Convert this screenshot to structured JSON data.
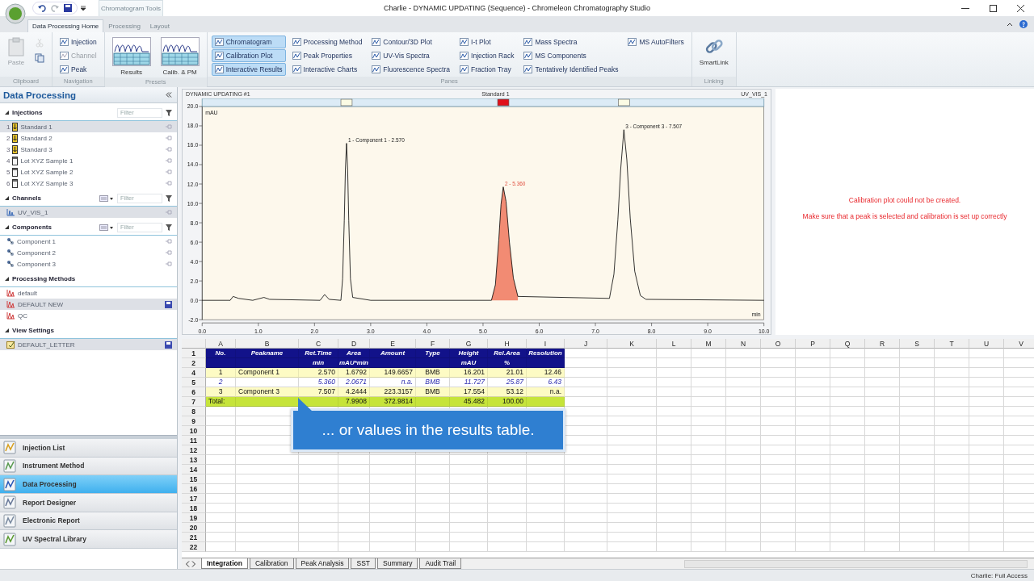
{
  "window": {
    "title": "Charlie - DYNAMIC UPDATING (Sequence) - Chromeleon Chromatography Studio",
    "context_group": "Chromatogram Tools"
  },
  "tabs": [
    {
      "label": "Data Processing Home",
      "selected": true,
      "context": false
    },
    {
      "label": "Processing",
      "selected": false,
      "context": true
    },
    {
      "label": "Layout",
      "selected": false,
      "context": true
    }
  ],
  "ribbon": [
    {
      "label": "Clipboard",
      "columns": [
        [
          {
            "label": "Paste",
            "kind": "paste",
            "disabled": true
          }
        ],
        [
          {
            "kind": "cut",
            "disabled": true
          },
          {
            "kind": "copy",
            "disabled": false
          }
        ]
      ]
    },
    {
      "label": "Navigation",
      "columns": [
        [
          {
            "label": "Injection",
            "kind": "nav",
            "disabled": false
          },
          {
            "label": "Channel",
            "kind": "nav",
            "disabled": true
          },
          {
            "label": "Peak",
            "kind": "nav",
            "disabled": false
          }
        ]
      ]
    },
    {
      "label": "Presets",
      "columns": [
        [
          {
            "label": "Results",
            "kind": "preset"
          }
        ],
        [
          {
            "label": "Calib. & PM",
            "kind": "preset"
          }
        ]
      ]
    },
    {
      "label": "Panes",
      "columns": [
        [
          {
            "label": "Chromatogram",
            "kind": "pane",
            "selected": true
          },
          {
            "label": "Calibration Plot",
            "kind": "pane",
            "selected": true
          },
          {
            "label": "Interactive Results",
            "kind": "pane",
            "selected": true
          }
        ],
        [
          {
            "label": "Processing Method",
            "kind": "pane",
            "selected": false
          },
          {
            "label": "Peak Properties",
            "kind": "pane",
            "selected": false
          },
          {
            "label": "Interactive Charts",
            "kind": "pane",
            "selected": false
          }
        ],
        [
          {
            "label": "Contour/3D Plot",
            "kind": "pane",
            "selected": false
          },
          {
            "label": "UV-Vis Spectra",
            "kind": "pane",
            "selected": false
          },
          {
            "label": "Fluorescence Spectra",
            "kind": "pane",
            "selected": false
          }
        ],
        [
          {
            "label": "I-t Plot",
            "kind": "pane",
            "selected": false
          },
          {
            "label": "Injection Rack",
            "kind": "pane",
            "selected": false
          },
          {
            "label": "Fraction Tray",
            "kind": "pane",
            "selected": false
          }
        ],
        [
          {
            "label": "Mass Spectra",
            "kind": "pane",
            "selected": false
          },
          {
            "label": "MS Components",
            "kind": "pane",
            "selected": false
          },
          {
            "label": "Tentatively Identified Peaks",
            "kind": "pane",
            "selected": false
          }
        ],
        [
          {
            "label": "MS AutoFilters",
            "kind": "pane",
            "selected": false
          }
        ]
      ]
    },
    {
      "label": "Linking",
      "columns": [
        [
          {
            "label": "SmartLink",
            "kind": "link"
          }
        ]
      ]
    }
  ],
  "sidebar": {
    "title": "Data Processing",
    "sections": [
      {
        "title": "Injections",
        "filter": {
          "placeholder": "Filter"
        },
        "view_menu": false,
        "items": [
          {
            "number": "1",
            "label": "Standard 1",
            "kind": "standard",
            "selected": true,
            "modified": false
          },
          {
            "number": "2",
            "label": "Standard 2",
            "kind": "standard",
            "selected": false,
            "modified": false
          },
          {
            "number": "3",
            "label": "Standard 3",
            "kind": "standard",
            "selected": false,
            "modified": false
          },
          {
            "number": "4",
            "label": "Lot XYZ Sample 1",
            "kind": "unknown",
            "selected": false,
            "modified": false
          },
          {
            "number": "5",
            "label": "Lot XYZ Sample 2",
            "kind": "unknown",
            "selected": false,
            "modified": false
          },
          {
            "number": "6",
            "label": "Lot XYZ Sample 3",
            "kind": "unknown",
            "selected": false,
            "modified": false
          }
        ]
      },
      {
        "title": "Channels",
        "filter": {
          "placeholder": "Filter"
        },
        "view_menu": true,
        "items": [
          {
            "label": "UV_VIS_1",
            "kind": "channel",
            "selected": true,
            "modified": false
          }
        ]
      },
      {
        "title": "Components",
        "filter": {
          "placeholder": "Filter"
        },
        "view_menu": true,
        "items": [
          {
            "label": "Component 1",
            "kind": "component",
            "selected": false,
            "modified": false
          },
          {
            "label": "Component 2",
            "kind": "component",
            "selected": false,
            "modified": false
          },
          {
            "label": "Component 3",
            "kind": "component",
            "selected": false,
            "modified": false
          }
        ]
      },
      {
        "title": "Processing Methods",
        "view_menu": false,
        "items": [
          {
            "label": "default",
            "kind": "method",
            "selected": false,
            "modified": false
          },
          {
            "label": "DEFAULT NEW",
            "kind": "method",
            "selected": true,
            "modified": true
          },
          {
            "label": "QC",
            "kind": "method",
            "selected": false,
            "modified": false
          }
        ]
      },
      {
        "title": "View Settings",
        "view_menu": false,
        "items": [
          {
            "label": "DEFAULT_LETTER",
            "kind": "view",
            "selected": true,
            "modified": true
          }
        ]
      }
    ],
    "nav": [
      {
        "label": "Injection List",
        "kind": "vials",
        "selected": false
      },
      {
        "label": "Instrument Method",
        "kind": "instrument",
        "selected": false
      },
      {
        "label": "Data Processing",
        "kind": "processing",
        "selected": true
      },
      {
        "label": "Report Designer",
        "kind": "report",
        "selected": false
      },
      {
        "label": "Electronic Report",
        "kind": "ereport",
        "selected": false
      },
      {
        "label": "UV Spectral Library",
        "kind": "library",
        "selected": false
      }
    ]
  },
  "chromatogram": {
    "title": "DYNAMIC UPDATING #1",
    "injection": "Standard 1",
    "channel": "UV_VIS_1",
    "peak_markers": [
      {
        "selected": false
      },
      {
        "selected": true
      },
      {
        "selected": false
      }
    ],
    "chart_data": {
      "type": "line",
      "xlabel": "min",
      "ylabel": "mAU",
      "xlim": [
        0,
        10
      ],
      "ylim": [
        -2,
        20
      ],
      "xticks": [
        {
          "value": 0,
          "label": "0.0"
        },
        {
          "value": 1,
          "label": "1.0"
        },
        {
          "value": 2,
          "label": "2.0"
        },
        {
          "value": 3,
          "label": "3.0"
        },
        {
          "value": 4,
          "label": "4.0"
        },
        {
          "value": 5,
          "label": "5.0"
        },
        {
          "value": 6,
          "label": "6.0"
        },
        {
          "value": 7,
          "label": "7.0"
        },
        {
          "value": 8,
          "label": "8.0"
        },
        {
          "value": 9,
          "label": "9.0"
        },
        {
          "value": 10,
          "label": "10.0"
        }
      ],
      "yticks": [
        {
          "value": -2,
          "label": "-2.0"
        },
        {
          "value": 0,
          "label": "0.0"
        },
        {
          "value": 2,
          "label": "2.0"
        },
        {
          "value": 4,
          "label": "4.0"
        },
        {
          "value": 6,
          "label": "6.0"
        },
        {
          "value": 8,
          "label": "8.0"
        },
        {
          "value": 10,
          "label": "10.0"
        },
        {
          "value": 12,
          "label": "12.0"
        },
        {
          "value": 14,
          "label": "14.0"
        },
        {
          "value": 16,
          "label": "16.0"
        },
        {
          "value": 18,
          "label": "18.0"
        },
        {
          "value": 20,
          "label": "20.0"
        }
      ],
      "x": [
        0,
        0.5,
        0.55,
        0.65,
        0.9,
        1.1,
        1.2,
        2.1,
        2.18,
        2.26,
        2.47,
        2.5,
        2.53,
        2.55,
        2.57,
        2.59,
        2.61,
        2.64,
        2.68,
        3.0,
        5.15,
        5.22,
        5.28,
        5.32,
        5.36,
        5.41,
        5.47,
        5.54,
        5.62,
        7.25,
        7.33,
        7.4,
        7.45,
        7.507,
        7.56,
        7.62,
        7.7,
        7.8,
        7.9,
        10
      ],
      "series": [
        {
          "color": "#000000",
          "values": [
            0,
            0,
            0.4,
            0.2,
            0,
            0.3,
            0.1,
            0,
            0.6,
            0.1,
            0,
            2.2,
            8.2,
            13.5,
            16.2,
            13.5,
            8.2,
            2.2,
            0.3,
            0,
            0,
            1.6,
            6.2,
            9.9,
            11.7,
            10.2,
            6,
            2.3,
            0.4,
            0.2,
            2.7,
            8.3,
            13.5,
            17.6,
            14.5,
            8.5,
            3,
            0.5,
            0.1,
            0
          ]
        }
      ],
      "annotations": [
        {
          "x": 2.57,
          "y": 16.2,
          "text": "1 - Component 1 - 2.570"
        },
        {
          "x": 5.36,
          "y": 11.7,
          "text": "2 - 5.360"
        },
        {
          "x": 7.507,
          "y": 17.6,
          "text": "3 - Component 3 - 7.507"
        }
      ]
    }
  },
  "calibration": {
    "messages": [
      "Calibration plot could not be created.",
      "Make sure that a peak is selected and calibration is set up correctly"
    ]
  },
  "results": {
    "column_letters": [
      "A",
      "B",
      "C",
      "D",
      "E",
      "F",
      "G",
      "H",
      "I",
      "J",
      "K",
      "L",
      "M",
      "N",
      "O",
      "P",
      "Q",
      "R",
      "S",
      "T",
      "U",
      "V"
    ],
    "row_numbers": [
      "1",
      "2",
      "4",
      "5",
      "6",
      "7",
      "8",
      "9",
      "10",
      "11",
      "12",
      "13",
      "14",
      "15",
      "16",
      "17",
      "18",
      "19",
      "20",
      "21",
      "22"
    ],
    "columns": [
      {
        "name": "No."
      },
      {
        "name": "Peakname"
      },
      {
        "name": "Ret.Time",
        "unit": "min"
      },
      {
        "name": "Area",
        "unit": "mAU*min"
      },
      {
        "name": "Amount"
      },
      {
        "name": "Type"
      },
      {
        "name": "Height",
        "unit": "mAU"
      },
      {
        "name": "Rel.Area",
        "unit": "%"
      },
      {
        "name": "Resolution"
      }
    ],
    "rows": [
      {
        "kind": "component",
        "cells": [
          "1",
          "Component 1",
          "2.570",
          "1.6792",
          "149.6657",
          "BMB",
          "16.201",
          "21.01",
          "12.46"
        ]
      },
      {
        "kind": "unidentified",
        "cells": [
          "2",
          null,
          "5.360",
          "2.0671",
          "n.a.",
          "BMB",
          "11.727",
          "25.87",
          "6.43"
        ]
      },
      {
        "kind": "component",
        "cells": [
          "3",
          "Component 3",
          "7.507",
          "4.2444",
          "223.3157",
          "BMB",
          "17.554",
          "53.12",
          "n.a."
        ]
      },
      {
        "kind": "total",
        "cells": [
          "Total:",
          null,
          null,
          "7.9908",
          "372.9814",
          null,
          "45.482",
          "100.00",
          null
        ]
      }
    ],
    "sheets": [
      {
        "label": "Integration",
        "selected": true
      },
      {
        "label": "Calibration",
        "selected": false
      },
      {
        "label": "Peak Analysis",
        "selected": false
      },
      {
        "label": "SST",
        "selected": false
      },
      {
        "label": "Summary",
        "selected": false
      },
      {
        "label": "Audit Trail",
        "selected": false
      }
    ]
  },
  "callout": {
    "text": "... or values in the results table."
  },
  "status_bar": {
    "user": "Charlie: Full Access"
  }
}
